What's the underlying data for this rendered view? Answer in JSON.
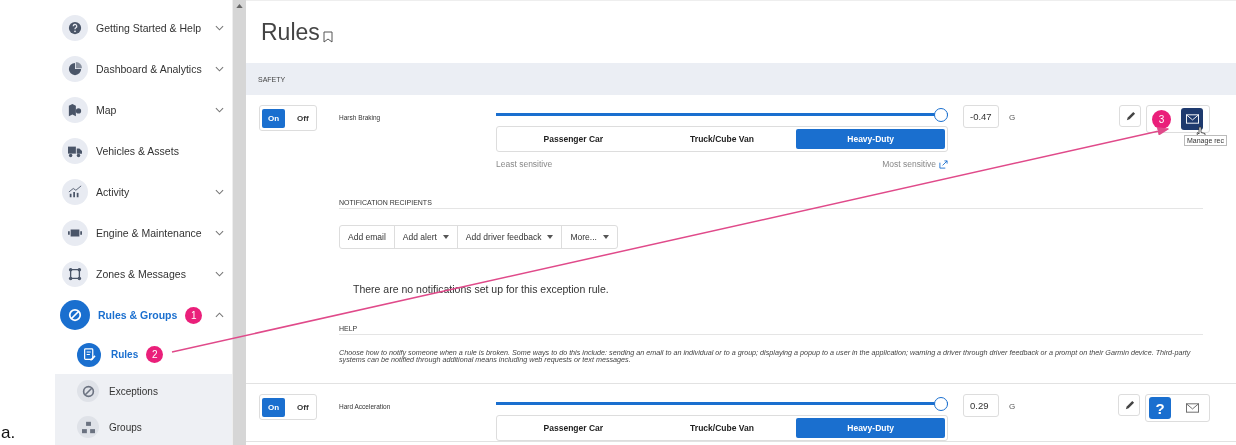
{
  "doc_label": "a.",
  "sidebar": {
    "items": [
      {
        "label": "Getting Started & Help",
        "expanded": false,
        "selected": false
      },
      {
        "label": "Dashboard & Analytics",
        "expanded": false,
        "selected": false
      },
      {
        "label": "Map",
        "expanded": false,
        "selected": false
      },
      {
        "label": "Vehicles & Assets",
        "selected": false
      },
      {
        "label": "Activity",
        "expanded": false,
        "selected": false
      },
      {
        "label": "Engine & Maintenance",
        "expanded": false,
        "selected": false
      },
      {
        "label": "Zones & Messages",
        "expanded": false,
        "selected": false
      },
      {
        "label": "Rules & Groups",
        "expanded": true,
        "selected": true,
        "badge": "1",
        "children": [
          {
            "label": "Rules",
            "selected": true,
            "badge": "2"
          },
          {
            "label": "Exceptions",
            "selected": false
          },
          {
            "label": "Groups",
            "selected": false
          }
        ]
      }
    ]
  },
  "page_title": "Rules",
  "section": "SAFETY",
  "rules": [
    {
      "toggle": [
        {
          "label": "On",
          "selected": true
        },
        {
          "label": "Off",
          "selected": false
        }
      ],
      "name": "Harsh Braking",
      "level": 1,
      "value": "-0.47",
      "unit": "G",
      "vehicle_types": [
        {
          "label": "Passenger Car",
          "selected": false
        },
        {
          "label": "Truck/Cube Van",
          "selected": false
        },
        {
          "label": "Heavy-Duty",
          "selected": true
        }
      ],
      "sensitivity": {
        "least": "Least sensitive",
        "most": "Most sensitive"
      },
      "actions": [
        {
          "kind": "edit"
        },
        {
          "kind": "badge",
          "label": "3"
        },
        {
          "kind": "email",
          "selected": true
        }
      ],
      "tooltip": "Manage rec",
      "notifications": {
        "heading": "NOTIFICATION RECIPIENTS",
        "buttons": [
          {
            "label": "Add email",
            "dropdown": false
          },
          {
            "label": "Add alert",
            "dropdown": true
          },
          {
            "label": "Add driver feedback",
            "dropdown": true
          },
          {
            "label": "More...",
            "dropdown": true
          }
        ],
        "empty_text": "There are no notifications set up for this exception rule."
      },
      "help": {
        "heading": "HELP",
        "text": "Choose how to notify someone when a rule is broken. Some ways to do this include: sending an email to an individual or to a group; displaying a popup to a user in the application; warning a driver through driver feedback or a prompt on their Garmin device. Third-party systems can be notified through additional means including web requests or text messages."
      }
    },
    {
      "toggle": [
        {
          "label": "On",
          "selected": true
        },
        {
          "label": "Off",
          "selected": false
        }
      ],
      "name": "Hard Acceleration",
      "level": 1,
      "value": "0.29",
      "unit": "G",
      "vehicle_types": [
        {
          "label": "Passenger Car",
          "selected": false
        },
        {
          "label": "Truck/Cube Van",
          "selected": false
        },
        {
          "label": "Heavy-Duty",
          "selected": true
        }
      ],
      "actions": [
        {
          "kind": "edit"
        },
        {
          "kind": "help",
          "glyph": "?",
          "selected": true
        },
        {
          "kind": "email",
          "selected": false
        }
      ]
    }
  ]
}
